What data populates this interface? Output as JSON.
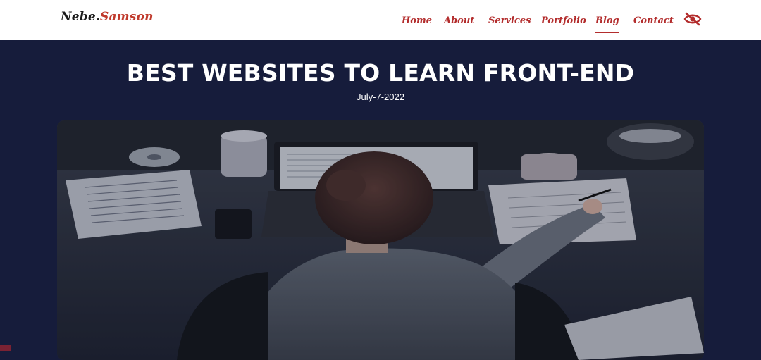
{
  "header": {
    "logo_part1": "Nebe.",
    "logo_part2": "Samson",
    "nav": [
      "Home",
      "About",
      "Services",
      "Portfolio",
      "Blog",
      "Contact"
    ],
    "active_nav": "Blog",
    "toggle_icon": "eye-slash-icon"
  },
  "post": {
    "title": "BEST WEBSITES TO LEARN FRONT-END",
    "date": "July-7-2022",
    "hero_image": "person-working-at-laptop-photo"
  },
  "colors": {
    "background": "#161c3b",
    "accent": "#b32d2d",
    "header_bg": "#ffffff"
  }
}
